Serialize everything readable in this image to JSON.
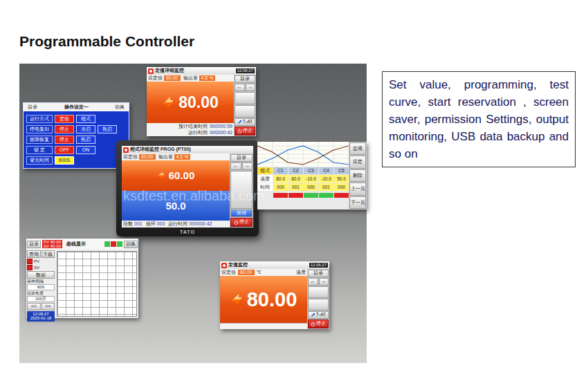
{
  "page": {
    "title": "Programmable Controller",
    "watermark": "ksdtest.en.alibaba.com"
  },
  "description": "Set value, programming, test curve, start reservation , screen saver, permission Settings, output monitoring, USB data backup and so on",
  "fixed_detail_screen": {
    "title": "定值详细监控",
    "clock": "12:06:27",
    "readings": [
      {
        "label": "设定值",
        "value": "80.00"
      },
      {
        "label": "输出量",
        "value": "4.5 %"
      }
    ],
    "pv": "80.00",
    "info": [
      {
        "label": "预计结束时间",
        "value": "000000:59"
      },
      {
        "label": "运行时间",
        "value": "000000:42"
      }
    ],
    "menu": "目录",
    "arrows": [
      "←",
      "→"
    ],
    "tune": "T-AT",
    "stop": "停止"
  },
  "operation_screen": {
    "menu": "目录",
    "title": "操作设定一",
    "switch": "切换",
    "rows": [
      {
        "label": "运行方式",
        "options": [
          {
            "label": "定值",
            "selected": true,
            "kind": "button"
          },
          {
            "label": "程式",
            "selected": false,
            "kind": "button"
          }
        ]
      },
      {
        "label": "停电复归",
        "options": [
          {
            "label": "停止",
            "selected": true,
            "kind": "button"
          },
          {
            "label": "冷启",
            "selected": false,
            "kind": "button"
          },
          {
            "label": "热启",
            "selected": false,
            "kind": "button"
          }
        ]
      },
      {
        "label": "故障恢复",
        "options": [
          {
            "label": "停止",
            "selected": true,
            "kind": "button"
          },
          {
            "label": "热启",
            "selected": false,
            "kind": "button"
          }
        ]
      },
      {
        "label": "锁 定",
        "options": [
          {
            "label": "OFF",
            "selected": true,
            "kind": "button"
          },
          {
            "label": "ON",
            "selected": false,
            "kind": "button"
          }
        ]
      },
      {
        "label": "背光时间",
        "options": [
          {
            "label": "600S",
            "selected": false,
            "kind": "field"
          }
        ]
      }
    ]
  },
  "program_device": {
    "brand": "TATO",
    "title": "程式详细监控 PROG (PT00)",
    "readings": [
      {
        "label": "设定值",
        "value": "60.00"
      },
      {
        "label": "输出量",
        "value": "4.5 %"
      }
    ],
    "pv": "60.00",
    "sv": "50.0",
    "info": [
      {
        "label": "段数",
        "value": "001"
      },
      {
        "label": "循环",
        "value": "000"
      },
      {
        "label": "运行时间",
        "value": "000000:42"
      }
    ],
    "menu": "目录",
    "arrows": [
      "←",
      "→"
    ],
    "hold": "保持",
    "stop": "停止"
  },
  "curve_table_screen": {
    "mode": "程式",
    "chart": {
      "series": [
        {
          "color": "#7a3b1c",
          "values": [
            80,
            50,
            0,
            -10,
            20,
            60,
            80
          ]
        },
        {
          "color": "#1f6fd1",
          "values": [
            -10,
            20,
            60,
            80,
            50,
            0,
            -10
          ]
        }
      ]
    },
    "columns": [
      "C1",
      "C2",
      "C3",
      "C4",
      "C5"
    ],
    "rows": [
      {
        "label": "温度",
        "cells": [
          "80.0",
          "60.0",
          "-10.0",
          "-10.0",
          "50.0"
        ]
      },
      {
        "label": "时间",
        "cells": [
          "000",
          "001",
          "000",
          "001",
          "000"
        ]
      }
    ],
    "indicators": [
      {
        "color": "#e02020"
      },
      {
        "color": "#e02020"
      },
      {
        "color": "#39c24a"
      },
      {
        "color": "#39c24a"
      },
      {
        "color": "#e02020"
      }
    ],
    "side": [
      "监视",
      "设定",
      "删除",
      "上一页",
      "下一页"
    ]
  },
  "curve_screen": {
    "menu": "目录",
    "status": [
      {
        "label": "PV",
        "value": "80.00"
      },
      {
        "label": "SV",
        "value": "80.00"
      }
    ],
    "title": "曲线显示",
    "switch": "切换",
    "tools": [
      "查询",
      "下载"
    ],
    "checks": [
      {
        "label": "PV",
        "checked": true
      },
      {
        "label": "SV",
        "checked": true
      }
    ],
    "data_label": "数据",
    "fields": [
      {
        "label": "采样间隔",
        "value": "60S"
      },
      {
        "label": "记录长度",
        "value": "100天"
      }
    ],
    "pager": [
      "<<",
      ">>"
    ],
    "time": "12:06:27",
    "date": "2025-01-18"
  },
  "fixed_monitor_screen": {
    "title": "定值监控",
    "clock": "12:06:27",
    "setpoint_label": "设定值",
    "setpoint": "80.00",
    "unit": "℃",
    "channel": "温度",
    "pv": "80.00",
    "menu": "目录",
    "arrows": [
      "←",
      "→"
    ],
    "tune": "T-AT",
    "stop": "停止"
  }
}
